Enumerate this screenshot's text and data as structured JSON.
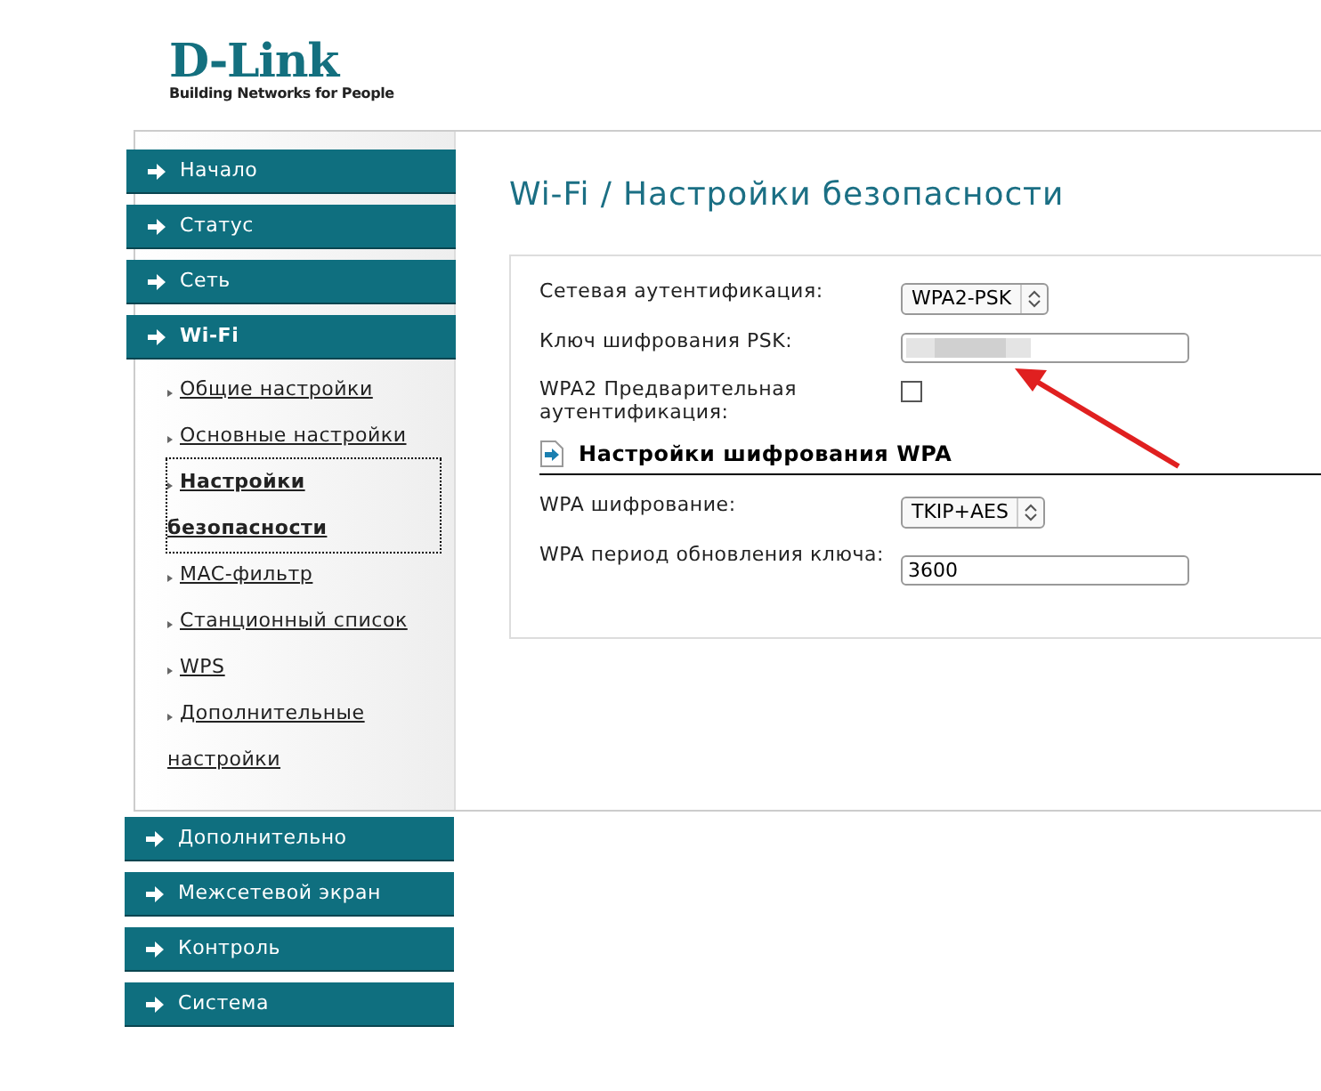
{
  "logo": {
    "name": "D-Link",
    "tagline": "Building Networks for People"
  },
  "sidebar": {
    "items": [
      {
        "label": "Начало",
        "expanded": false
      },
      {
        "label": "Статус",
        "expanded": false
      },
      {
        "label": "Сеть",
        "expanded": false
      },
      {
        "label": "Wi-Fi",
        "expanded": true,
        "children": [
          {
            "label": "Общие настройки",
            "selected": false
          },
          {
            "label": "Основные настройки",
            "selected": false
          },
          {
            "label": "Настройки безопасности",
            "selected": true
          },
          {
            "label": "MAC-фильтр",
            "selected": false
          },
          {
            "label": "Станционный список",
            "selected": false
          },
          {
            "label": "WPS",
            "selected": false
          },
          {
            "label": "Дополнительные настройки",
            "selected": false
          }
        ]
      },
      {
        "label": "Дополнительно",
        "expanded": false
      },
      {
        "label": "Межсетевой экран",
        "expanded": false
      },
      {
        "label": "Контроль",
        "expanded": false
      },
      {
        "label": "Система",
        "expanded": false
      }
    ]
  },
  "page_title": "Wi-Fi / Настройки безопасности",
  "form": {
    "rows": [
      {
        "kind": "select",
        "label": "Сетевая аутентификация:",
        "value": "WPA2-PSK"
      },
      {
        "kind": "masked",
        "label": "Ключ шифрования PSK:"
      },
      {
        "kind": "checkbox",
        "label": "WPA2 Предварительная аутентификация:",
        "checked": false
      },
      {
        "kind": "heading",
        "label": "Настройки шифрования WPA"
      },
      {
        "kind": "select",
        "label": "WPA шифрование:",
        "value": "TKIP+AES"
      },
      {
        "kind": "text",
        "label": "WPA период обновления ключа:",
        "value": "3600"
      }
    ]
  }
}
